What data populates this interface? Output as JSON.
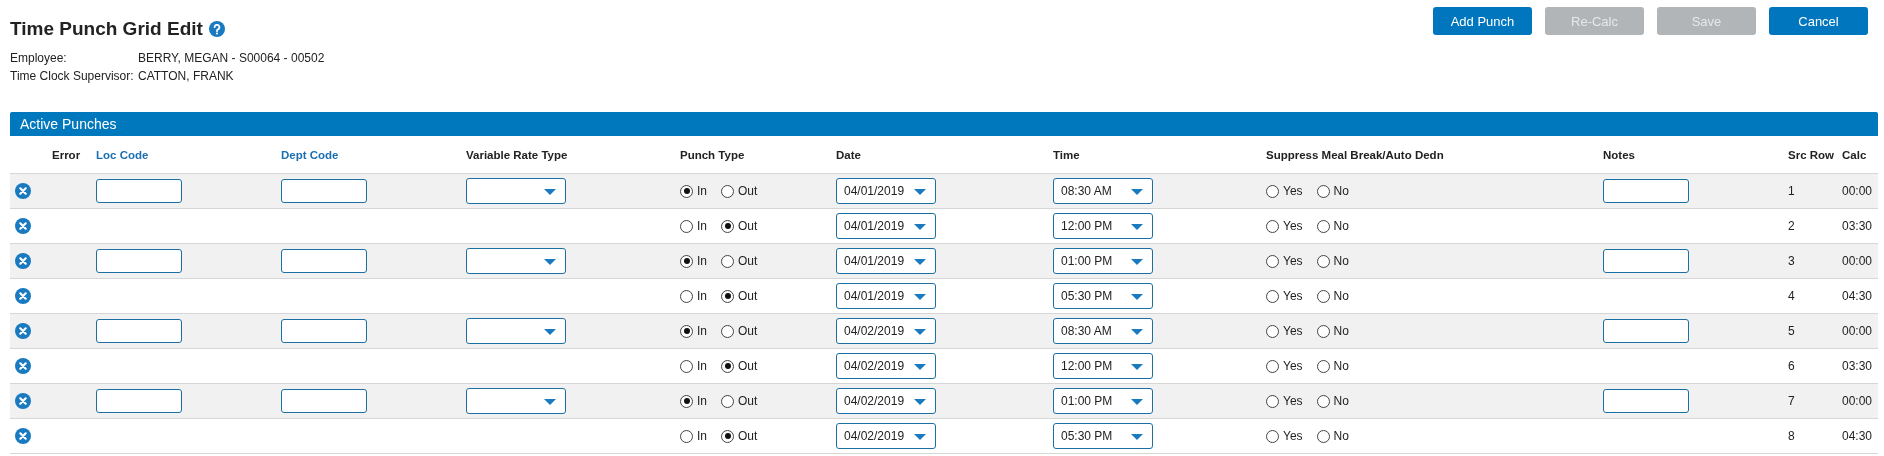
{
  "page": {
    "title": "Time Punch Grid Edit"
  },
  "buttons": [
    {
      "label": "Add Punch",
      "disabled": false
    },
    {
      "label": "Re-Calc",
      "disabled": true
    },
    {
      "label": "Save",
      "disabled": true
    },
    {
      "label": "Cancel",
      "disabled": false
    }
  ],
  "info": [
    {
      "label": "Employee:",
      "value": "BERRY, MEGAN - S00064 - 00502"
    },
    {
      "label": "Time Clock Supervisor:",
      "value": "CATTON, FRANK"
    }
  ],
  "panel": {
    "title": "Active Punches"
  },
  "columns": [
    {
      "label": "Error",
      "kind": "plain"
    },
    {
      "label": "Loc Code",
      "kind": "link"
    },
    {
      "label": "Dept Code",
      "kind": "link"
    },
    {
      "label": "Variable Rate Type",
      "kind": "plain"
    },
    {
      "label": "Punch Type",
      "kind": "plain"
    },
    {
      "label": "Date",
      "kind": "plain"
    },
    {
      "label": "Time",
      "kind": "plain"
    },
    {
      "label": "Suppress Meal Break/Auto Dedn",
      "kind": "plain"
    },
    {
      "label": "Notes",
      "kind": "plain"
    },
    {
      "label": "Src Row",
      "kind": "plain"
    },
    {
      "label": "Calc",
      "kind": "plain"
    }
  ],
  "rows": [
    {
      "editable": true,
      "punch_type": [
        {
          "label": "In",
          "selected": true
        },
        {
          "label": "Out",
          "selected": false
        }
      ],
      "date": "04/01/2019",
      "time": "08:30 AM",
      "suppress": [
        {
          "label": "Yes",
          "selected": false
        },
        {
          "label": "No",
          "selected": false
        }
      ],
      "src_row": "1",
      "calc": "00:00"
    },
    {
      "editable": false,
      "punch_type": [
        {
          "label": "In",
          "selected": false
        },
        {
          "label": "Out",
          "selected": true
        }
      ],
      "date": "04/01/2019",
      "time": "12:00 PM",
      "suppress": [
        {
          "label": "Yes",
          "selected": false
        },
        {
          "label": "No",
          "selected": false
        }
      ],
      "src_row": "2",
      "calc": "03:30"
    },
    {
      "editable": true,
      "punch_type": [
        {
          "label": "In",
          "selected": true
        },
        {
          "label": "Out",
          "selected": false
        }
      ],
      "date": "04/01/2019",
      "time": "01:00 PM",
      "suppress": [
        {
          "label": "Yes",
          "selected": false
        },
        {
          "label": "No",
          "selected": false
        }
      ],
      "src_row": "3",
      "calc": "00:00"
    },
    {
      "editable": false,
      "punch_type": [
        {
          "label": "In",
          "selected": false
        },
        {
          "label": "Out",
          "selected": true
        }
      ],
      "date": "04/01/2019",
      "time": "05:30 PM",
      "suppress": [
        {
          "label": "Yes",
          "selected": false
        },
        {
          "label": "No",
          "selected": false
        }
      ],
      "src_row": "4",
      "calc": "04:30"
    },
    {
      "editable": true,
      "punch_type": [
        {
          "label": "In",
          "selected": true
        },
        {
          "label": "Out",
          "selected": false
        }
      ],
      "date": "04/02/2019",
      "time": "08:30 AM",
      "suppress": [
        {
          "label": "Yes",
          "selected": false
        },
        {
          "label": "No",
          "selected": false
        }
      ],
      "src_row": "5",
      "calc": "00:00"
    },
    {
      "editable": false,
      "punch_type": [
        {
          "label": "In",
          "selected": false
        },
        {
          "label": "Out",
          "selected": true
        }
      ],
      "date": "04/02/2019",
      "time": "12:00 PM",
      "suppress": [
        {
          "label": "Yes",
          "selected": false
        },
        {
          "label": "No",
          "selected": false
        }
      ],
      "src_row": "6",
      "calc": "03:30"
    },
    {
      "editable": true,
      "punch_type": [
        {
          "label": "In",
          "selected": true
        },
        {
          "label": "Out",
          "selected": false
        }
      ],
      "date": "04/02/2019",
      "time": "01:00 PM",
      "suppress": [
        {
          "label": "Yes",
          "selected": false
        },
        {
          "label": "No",
          "selected": false
        }
      ],
      "src_row": "7",
      "calc": "00:00"
    },
    {
      "editable": false,
      "punch_type": [
        {
          "label": "In",
          "selected": false
        },
        {
          "label": "Out",
          "selected": true
        }
      ],
      "date": "04/02/2019",
      "time": "05:30 PM",
      "suppress": [
        {
          "label": "Yes",
          "selected": false
        },
        {
          "label": "No",
          "selected": false
        }
      ],
      "src_row": "8",
      "calc": "04:30"
    }
  ]
}
